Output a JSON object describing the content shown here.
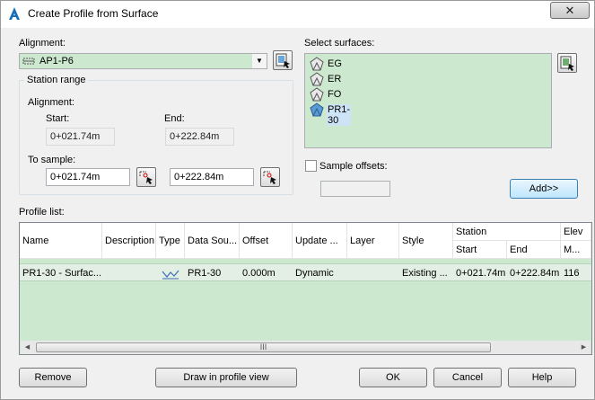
{
  "window": {
    "title": "Create Profile from Surface"
  },
  "alignment": {
    "label": "Alignment:",
    "selected": "AP1-P6"
  },
  "station_range": {
    "title": "Station range",
    "alignment_label": "Alignment:",
    "start_label": "Start:",
    "end_label": "End:",
    "start_value": "0+021.74m",
    "end_value": "0+222.84m",
    "to_sample_label": "To sample:",
    "sample_start": "0+021.74m",
    "sample_end": "0+222.84m"
  },
  "surfaces": {
    "label": "Select surfaces:",
    "items": [
      "EG",
      "ER",
      "FO",
      "PR1-30"
    ],
    "selected": "PR1-30"
  },
  "sample_offsets": {
    "label": "Sample offsets:",
    "checked": false
  },
  "add_button": "Add>>",
  "profile_list": {
    "label": "Profile list:",
    "headers": {
      "name": "Name",
      "description": "Description",
      "type": "Type",
      "data_source": "Data Sou...",
      "offset": "Offset",
      "update_mode": "Update ...",
      "layer": "Layer",
      "style": "Style",
      "station": "Station",
      "station_start": "Start",
      "station_end": "End",
      "elevation": "Elev",
      "elevation_min": "M..."
    },
    "rows": [
      {
        "name": "PR1-30 - Surfac...",
        "description": "",
        "type_icon": "profile-line-icon",
        "data_source": "PR1-30",
        "offset": "0.000m",
        "update_mode": "Dynamic",
        "layer": "",
        "style": "Existing ...",
        "station_start": "0+021.74m",
        "station_end": "0+222.84m",
        "elevation_min": "116"
      }
    ],
    "scroll_grip": "III"
  },
  "buttons": {
    "remove": "Remove",
    "draw": "Draw in profile view",
    "ok": "OK",
    "cancel": "Cancel",
    "help": "Help"
  },
  "colors": {
    "list_background": "#cce8cf",
    "primary_button": "#bee6fd",
    "selection": "#cde4f7"
  }
}
